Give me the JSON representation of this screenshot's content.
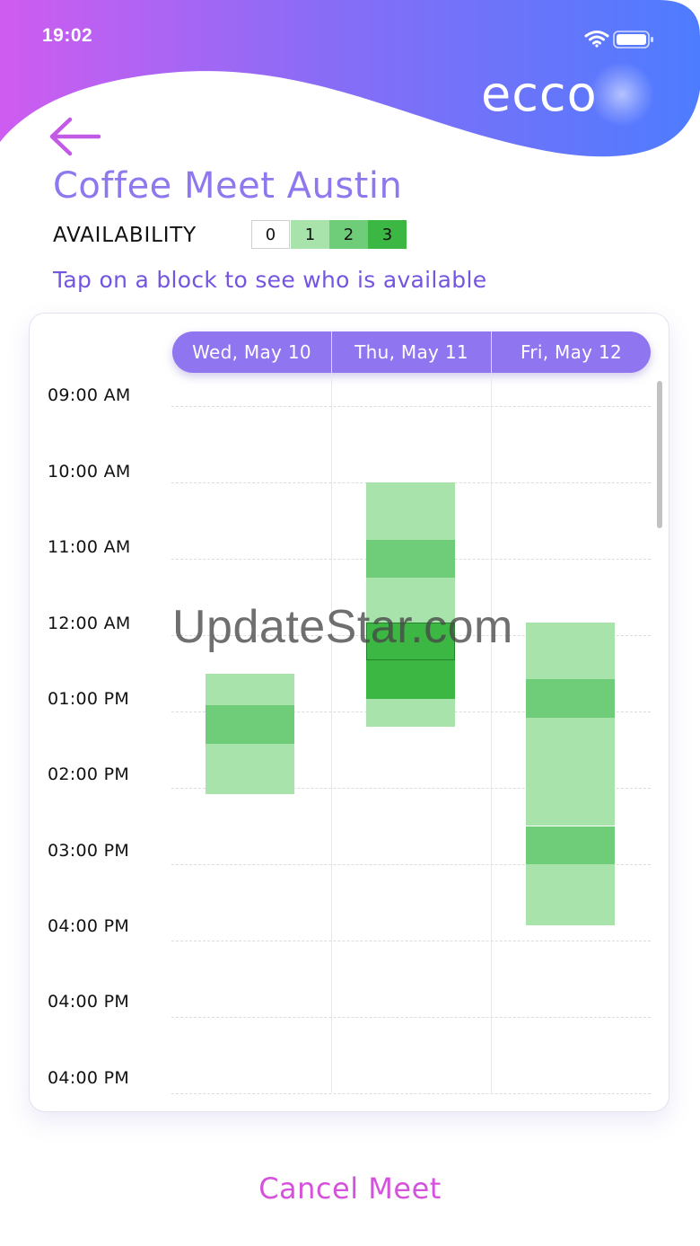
{
  "status_bar": {
    "time": "19:02",
    "wifi_icon": "wifi-icon",
    "battery_icon": "battery-icon"
  },
  "header": {
    "logo_text": "ecco",
    "back_icon": "arrow-left-icon"
  },
  "meet": {
    "title": "Coffee Meet Austin",
    "availability_label": "AVAILABILITY",
    "legend": [
      {
        "label": "0",
        "color": "#ffffff"
      },
      {
        "label": "1",
        "color": "#a7e3ab"
      },
      {
        "label": "2",
        "color": "#6fcd79"
      },
      {
        "label": "3",
        "color": "#3cb744"
      }
    ],
    "hint": "Tap on a block to see who is available"
  },
  "calendar": {
    "days": [
      "Wed, May 10",
      "Thu, May 11",
      "Fri, May 12"
    ],
    "time_labels": [
      "09:00 AM",
      "10:00 AM",
      "11:00 AM",
      "12:00 AM",
      "01:00 PM",
      "02:00 PM",
      "03:00 PM",
      "04:00 PM",
      "04:00 PM",
      "04:00 PM"
    ],
    "availability_blocks": [
      {
        "day": "Wed, May 10",
        "start_hour": 12.5,
        "end_hour": 12.92,
        "level": 1
      },
      {
        "day": "Wed, May 10",
        "start_hour": 12.92,
        "end_hour": 13.42,
        "level": 2
      },
      {
        "day": "Wed, May 10",
        "start_hour": 13.42,
        "end_hour": 14.08,
        "level": 1
      },
      {
        "day": "Thu, May 11",
        "start_hour": 10.0,
        "end_hour": 10.75,
        "level": 1
      },
      {
        "day": "Thu, May 11",
        "start_hour": 10.75,
        "end_hour": 11.25,
        "level": 2
      },
      {
        "day": "Thu, May 11",
        "start_hour": 11.25,
        "end_hour": 11.83,
        "level": 1
      },
      {
        "day": "Thu, May 11",
        "start_hour": 11.83,
        "end_hour": 12.33,
        "level": 3,
        "selected": true
      },
      {
        "day": "Thu, May 11",
        "start_hour": 12.33,
        "end_hour": 12.83,
        "level": 3
      },
      {
        "day": "Thu, May 11",
        "start_hour": 12.83,
        "end_hour": 13.2,
        "level": 1
      },
      {
        "day": "Fri, May 12",
        "start_hour": 11.83,
        "end_hour": 12.58,
        "level": 1
      },
      {
        "day": "Fri, May 12",
        "start_hour": 12.58,
        "end_hour": 13.08,
        "level": 2
      },
      {
        "day": "Fri, May 12",
        "start_hour": 13.08,
        "end_hour": 14.5,
        "level": 1
      },
      {
        "day": "Fri, May 12",
        "start_hour": 14.5,
        "end_hour": 15.0,
        "level": 2
      },
      {
        "day": "Fri, May 12",
        "start_hour": 15.0,
        "end_hour": 15.8,
        "level": 1
      }
    ]
  },
  "watermark": "UpdateStar.com",
  "footer": {
    "cancel_label": "Cancel Meet"
  }
}
